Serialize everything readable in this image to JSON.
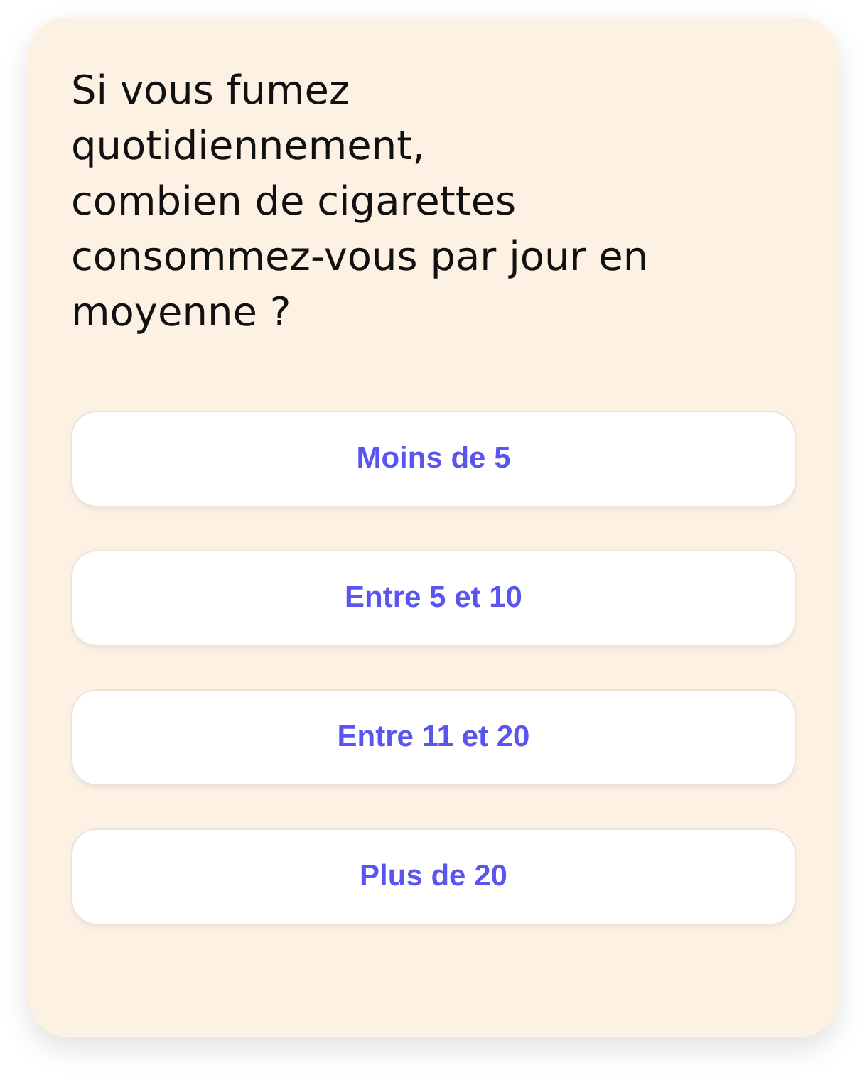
{
  "question": "Si vous fumez\nquotidiennement,\ncombien de cigarettes\nconsommez-vous par jour en\nmoyenne ?",
  "options": [
    {
      "label": "Moins de 5"
    },
    {
      "label": "Entre 5 et 10"
    },
    {
      "label": "Entre 11 et 20"
    },
    {
      "label": "Plus de 20"
    }
  ]
}
